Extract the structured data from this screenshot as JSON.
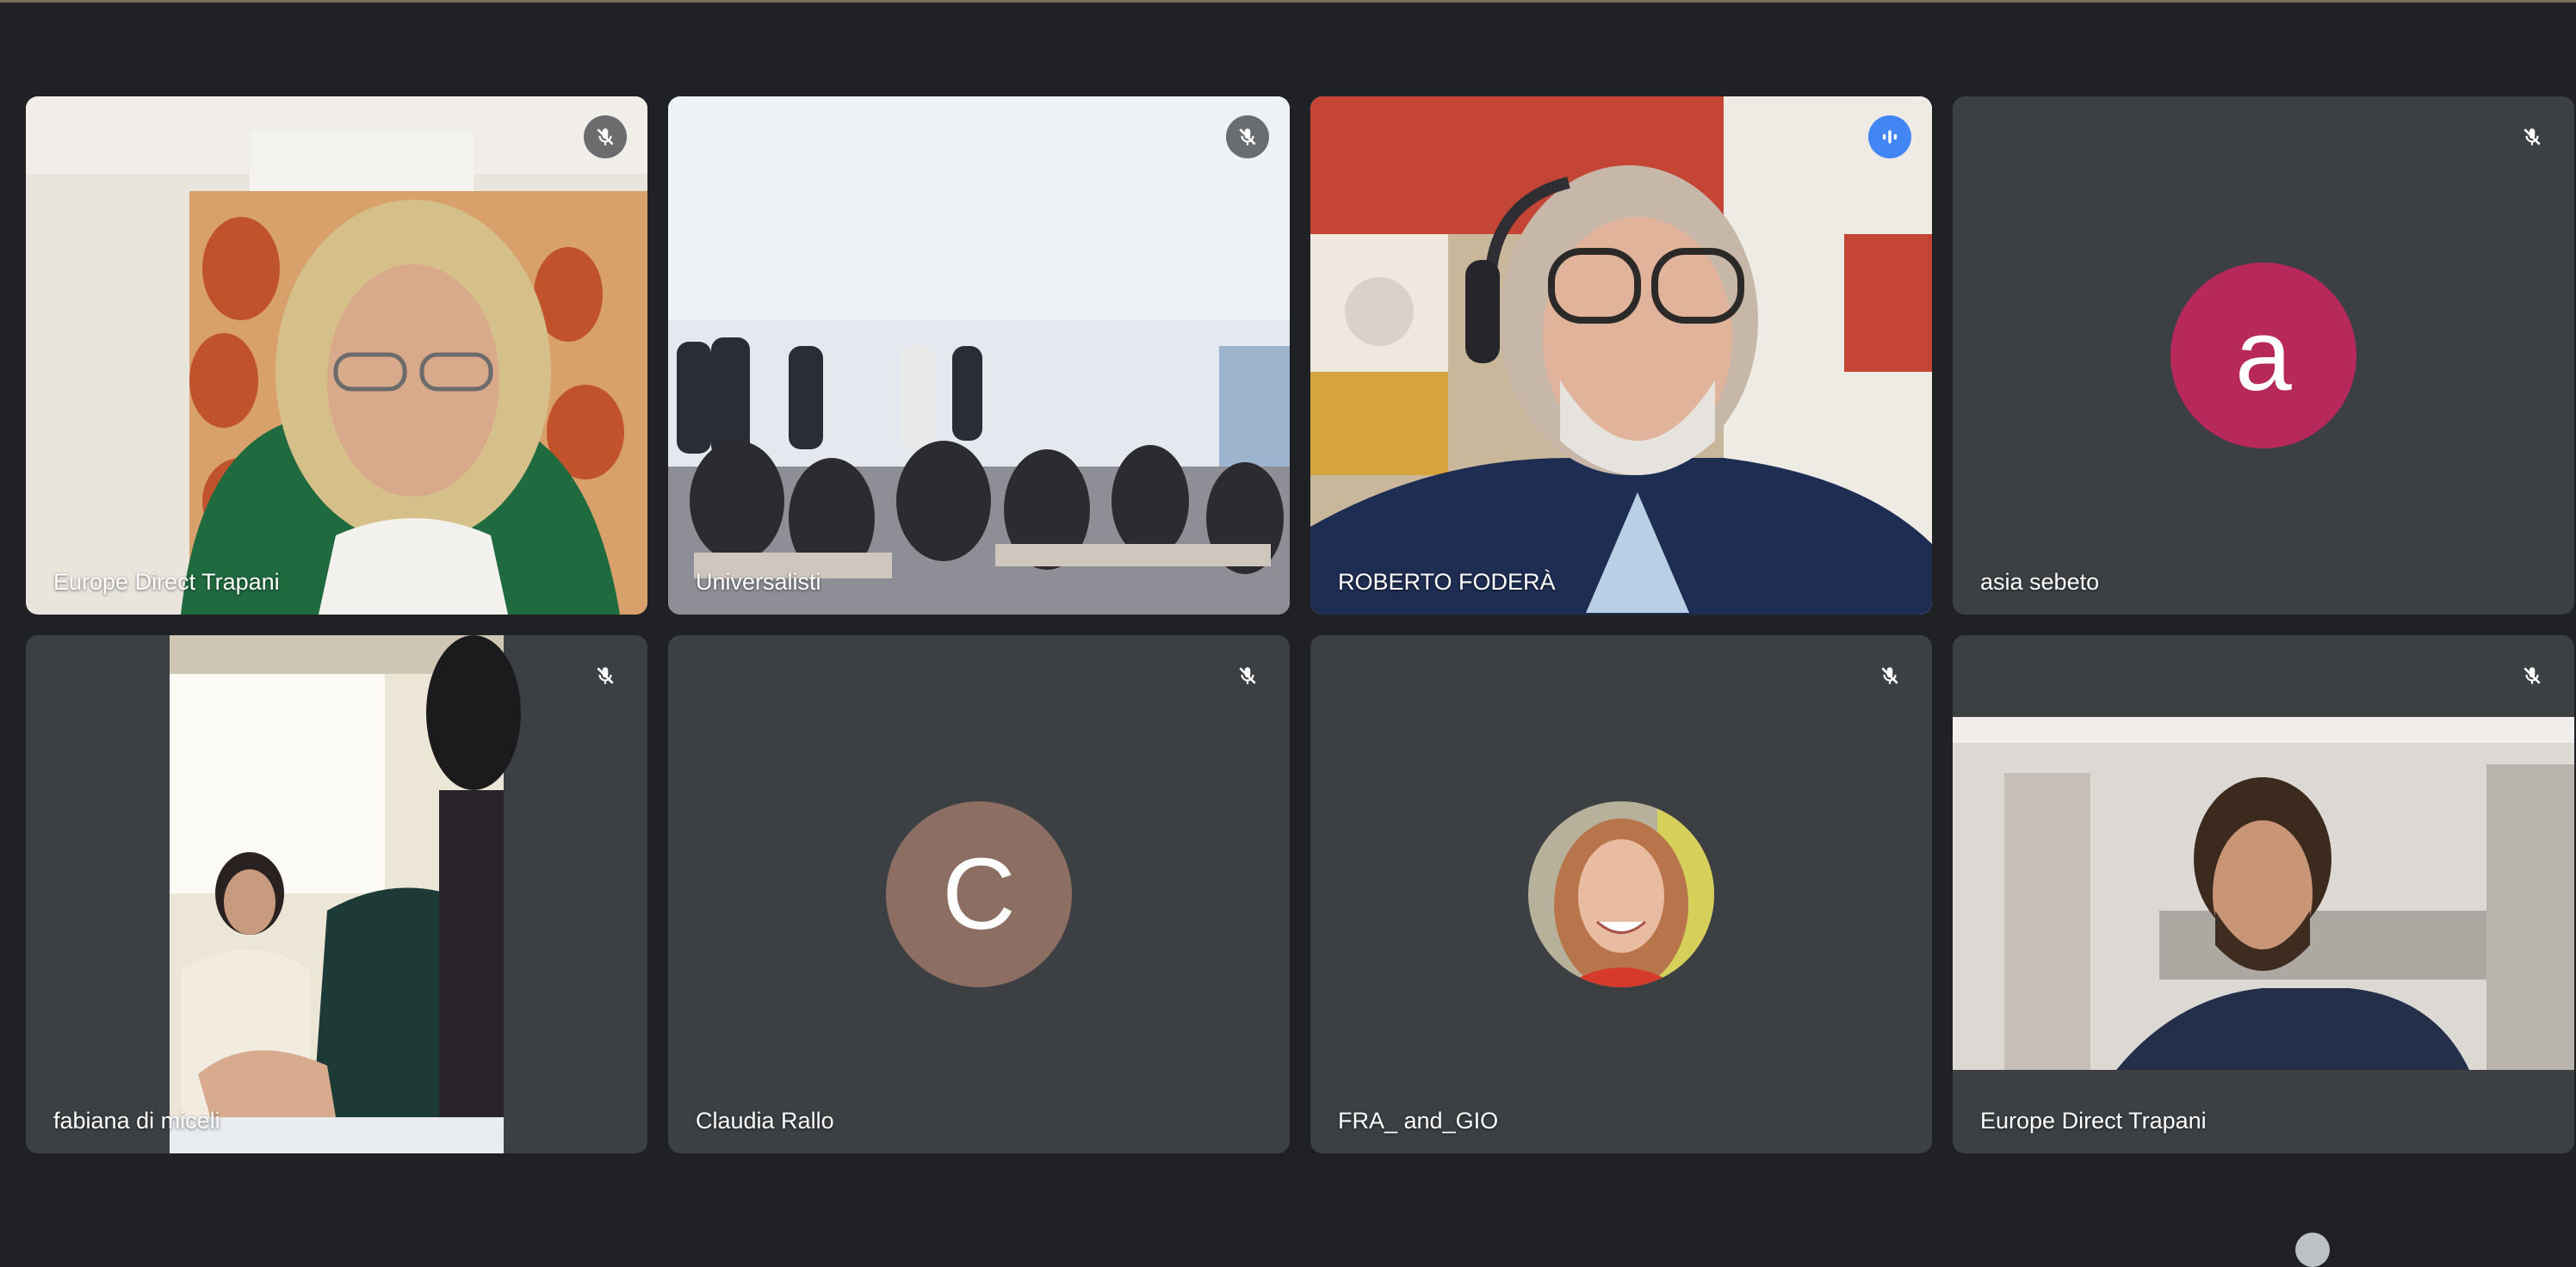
{
  "participants": [
    {
      "name": "Europe Direct Trapani",
      "mic": "muted",
      "view": "video"
    },
    {
      "name": "Universalisti",
      "mic": "muted",
      "view": "video"
    },
    {
      "name": "ROBERTO FODERÀ",
      "mic": "speaking",
      "view": "video"
    },
    {
      "name": "asia sebeto",
      "mic": "muted",
      "view": "avatar",
      "avatar_letter": "a",
      "avatar_color": "#b6295a"
    },
    {
      "name": "fabiana di miceli",
      "mic": "muted",
      "view": "video"
    },
    {
      "name": "Claudia Rallo",
      "mic": "muted",
      "view": "avatar",
      "avatar_letter": "C",
      "avatar_color": "#8d6e63"
    },
    {
      "name": "FRA_ and_GIO",
      "mic": "muted",
      "view": "photo-avatar"
    },
    {
      "name": "Europe Direct Trapani",
      "mic": "muted",
      "view": "video"
    }
  ],
  "colors": {
    "background": "#202124",
    "tile": "#3c4043",
    "speaking_border": "#8ab4f8",
    "speaking_badge": "#4285f4"
  },
  "icons": {
    "muted": "mic-off-icon",
    "speaking": "audio-level-icon"
  }
}
